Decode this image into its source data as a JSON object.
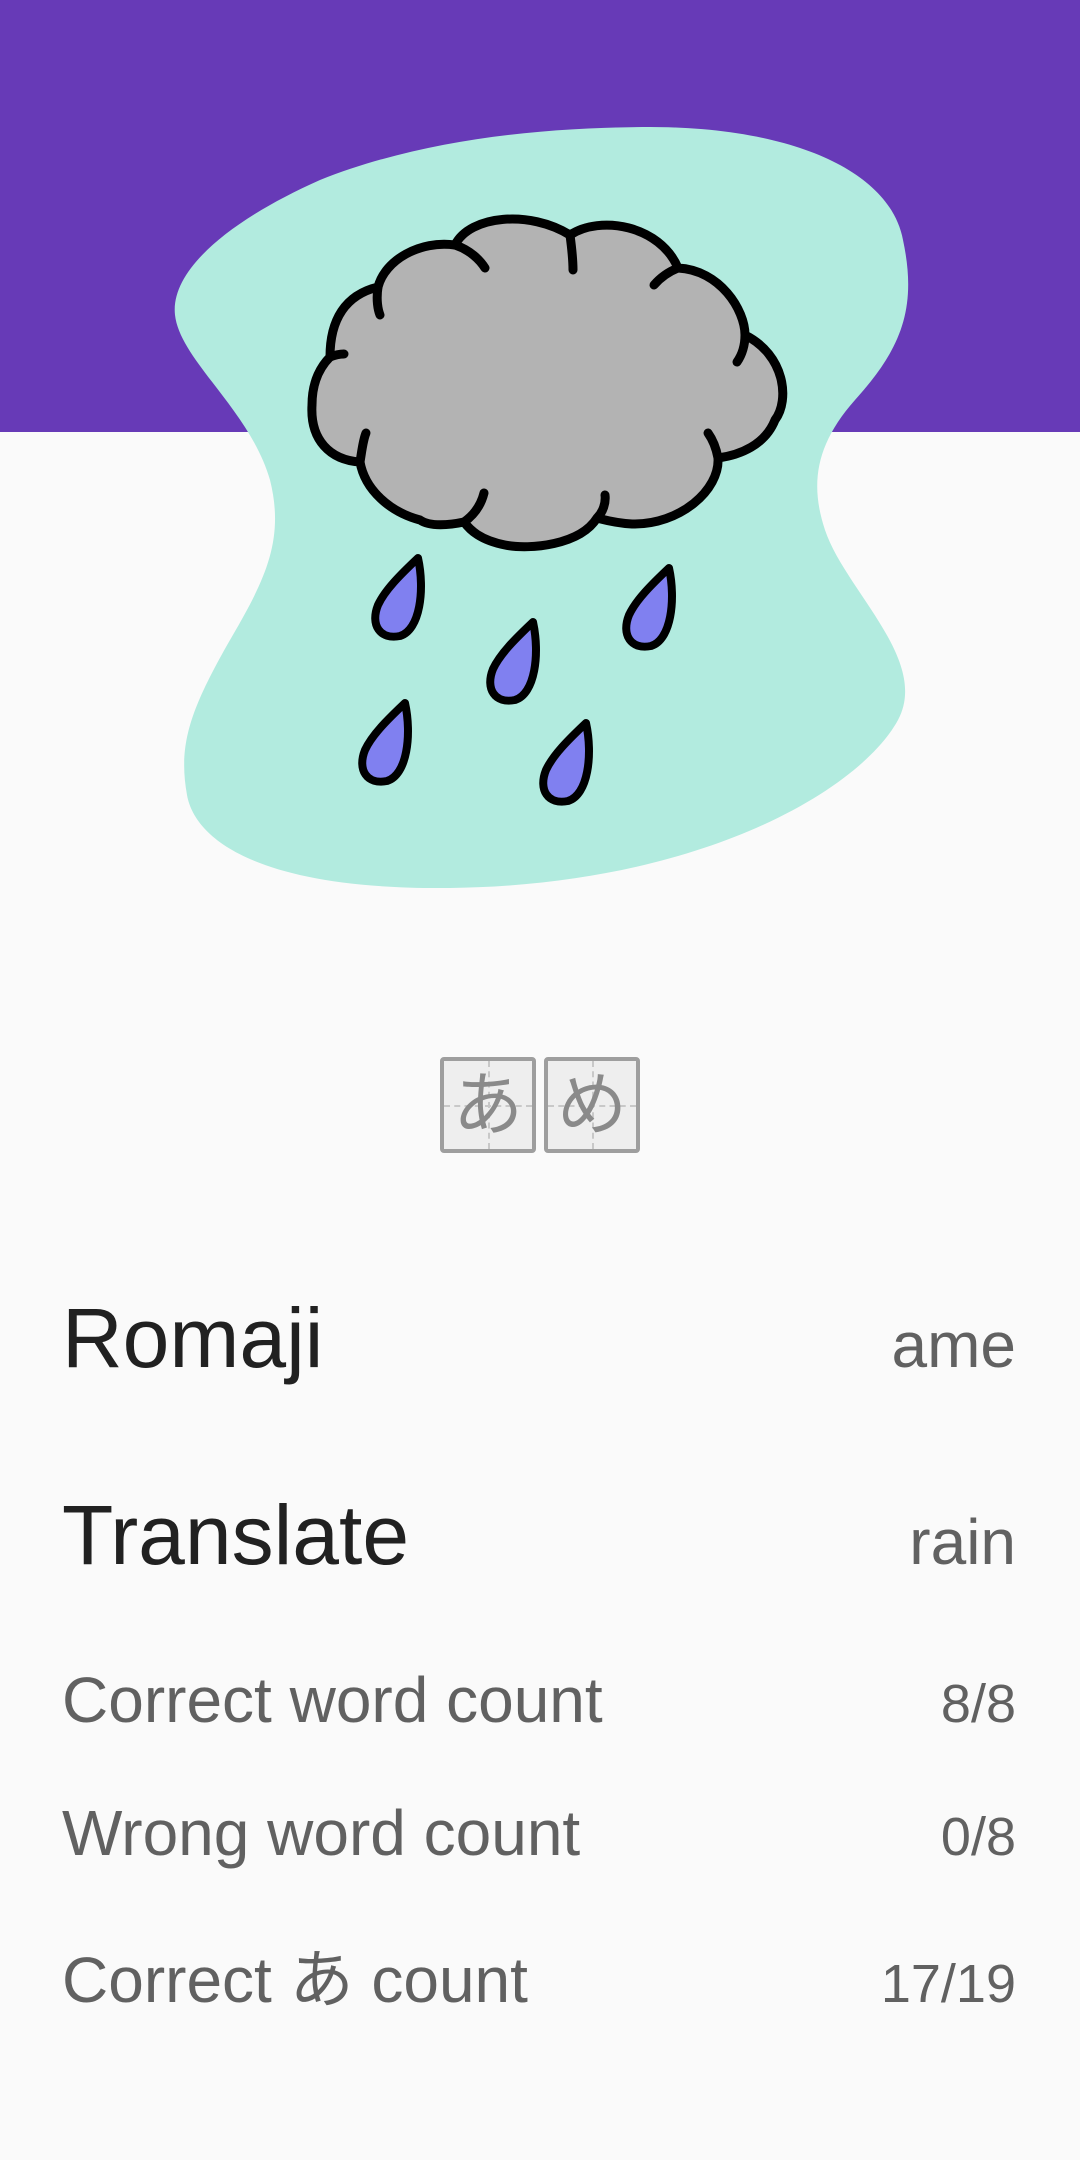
{
  "colors": {
    "header": "#673ab7",
    "blob": "#b2ebdf",
    "cloud": "#b3b3b3",
    "drop": "#8080f0",
    "background": "#fafafa"
  },
  "illustration": {
    "subject": "rain-cloud-icon"
  },
  "word": {
    "kana": [
      "あ",
      "め"
    ]
  },
  "details": {
    "romaji_label": "Romaji",
    "romaji_value": "ame",
    "translate_label": "Translate",
    "translate_value": "rain"
  },
  "stats": {
    "correct_word_label": "Correct word count",
    "correct_word_value": "8/8",
    "wrong_word_label": "Wrong word count",
    "wrong_word_value": "0/8",
    "correct_kana_label": "Correct あ count",
    "correct_kana_value": "17/19"
  }
}
